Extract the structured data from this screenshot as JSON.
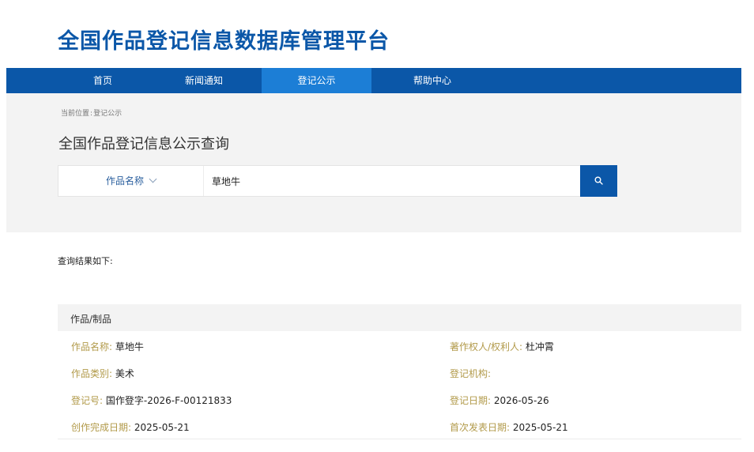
{
  "site": {
    "title": "全国作品登记信息数据库管理平台"
  },
  "nav": {
    "items": [
      {
        "label": "首页"
      },
      {
        "label": "新闻通知"
      },
      {
        "label": "登记公示"
      },
      {
        "label": "帮助中心"
      }
    ],
    "active_label": "登记公示"
  },
  "breadcrumb": {
    "prefix": "当前位置",
    "separator": ":",
    "current": "登记公示"
  },
  "search": {
    "title": "全国作品登记信息公示查询",
    "field_type": "作品名称",
    "query": "草地牛",
    "button_icon": "search-icon"
  },
  "results": {
    "label": "查询结果如下:",
    "card": {
      "category": "作品/制品",
      "fields": [
        {
          "label": "作品名称:",
          "value": "草地牛"
        },
        {
          "label": "著作权人/权利人:",
          "value": "杜冲霄"
        },
        {
          "label": "作品类别:",
          "value": "美术"
        },
        {
          "label": "登记机构:",
          "value": ""
        },
        {
          "label": "登记号:",
          "value": "国作登字-2026-F-00121833"
        },
        {
          "label": "登记日期:",
          "value": "2026-05-26"
        },
        {
          "label": "创作完成日期:",
          "value": "2025-05-21"
        },
        {
          "label": "首次发表日期:",
          "value": "2025-05-21"
        }
      ]
    }
  },
  "colors": {
    "primary": "#0b57a8",
    "nav_active": "#1c7ed6",
    "panel_bg": "#f3f3f3",
    "field_label": "#b29a4a"
  }
}
